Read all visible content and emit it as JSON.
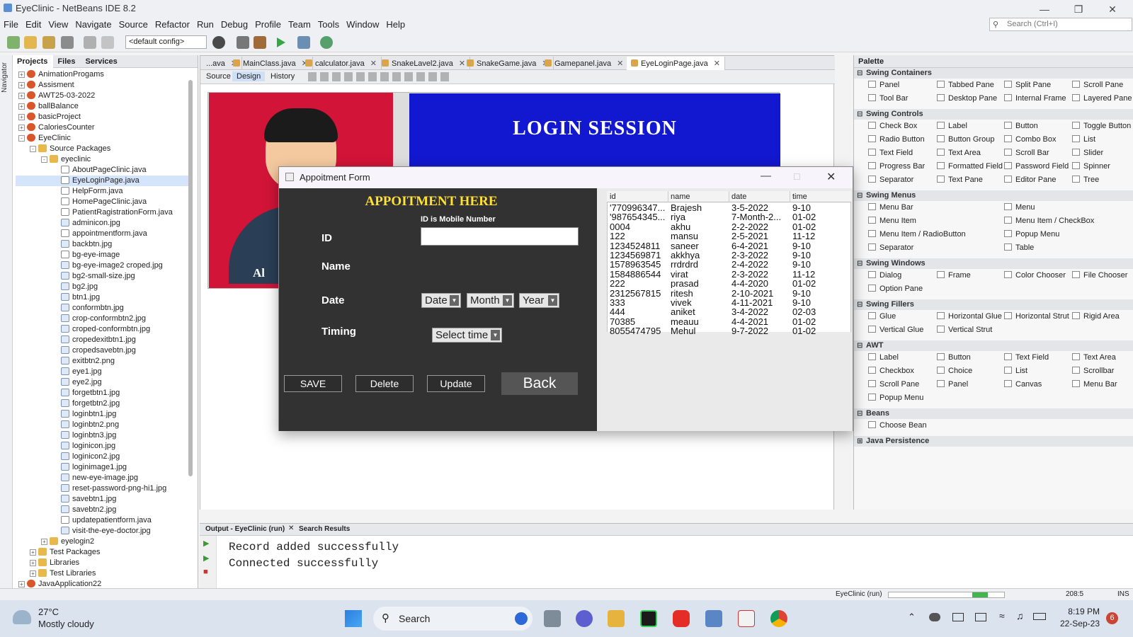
{
  "window": {
    "title": "EyeClinic - NetBeans IDE 8.2"
  },
  "menubar": [
    "File",
    "Edit",
    "View",
    "Navigate",
    "Source",
    "Refactor",
    "Run",
    "Debug",
    "Profile",
    "Team",
    "Tools",
    "Window",
    "Help"
  ],
  "toolbar": {
    "config": "<default config>",
    "search_placeholder": "Search (Ctrl+I)"
  },
  "left_panel": {
    "tabs": [
      "Projects",
      "Files",
      "Services"
    ],
    "side_label": "Navigator",
    "tree": [
      {
        "label": "AnimationProgams",
        "depth": 0,
        "type": "cup",
        "exp": "+"
      },
      {
        "label": "Assisment",
        "depth": 0,
        "type": "cup",
        "exp": "+"
      },
      {
        "label": "AWT25-03-2022",
        "depth": 0,
        "type": "cup",
        "exp": "+"
      },
      {
        "label": "ballBalance",
        "depth": 0,
        "type": "cup",
        "exp": "+"
      },
      {
        "label": "basicProject",
        "depth": 0,
        "type": "cup",
        "exp": "+"
      },
      {
        "label": "CaloriesCounter",
        "depth": 0,
        "type": "cup",
        "exp": "+"
      },
      {
        "label": "EyeClinic",
        "depth": 0,
        "type": "cup",
        "exp": "-"
      },
      {
        "label": "Source Packages",
        "depth": 1,
        "type": "pkg",
        "exp": "-"
      },
      {
        "label": "eyeclinic",
        "depth": 2,
        "type": "pkg",
        "exp": "-"
      },
      {
        "label": "AboutPageClinic.java",
        "depth": 3,
        "type": "file"
      },
      {
        "label": "EyeLoginPage.java",
        "depth": 3,
        "type": "file",
        "selected": true
      },
      {
        "label": "HelpForm.java",
        "depth": 3,
        "type": "file"
      },
      {
        "label": "HomePageClinic.java",
        "depth": 3,
        "type": "file"
      },
      {
        "label": "PatientRagistrationForm.java",
        "depth": 3,
        "type": "file"
      },
      {
        "label": "adminicon.jpg",
        "depth": 3,
        "type": "img"
      },
      {
        "label": "appointmentform.java",
        "depth": 3,
        "type": "file"
      },
      {
        "label": "backbtn.jpg",
        "depth": 3,
        "type": "img"
      },
      {
        "label": "bg-eye-image",
        "depth": 3,
        "type": "file"
      },
      {
        "label": "bg-eye-image2 croped.jpg",
        "depth": 3,
        "type": "img"
      },
      {
        "label": "bg2-small-size.jpg",
        "depth": 3,
        "type": "img"
      },
      {
        "label": "bg2.jpg",
        "depth": 3,
        "type": "img"
      },
      {
        "label": "btn1.jpg",
        "depth": 3,
        "type": "img"
      },
      {
        "label": "conformbtn.jpg",
        "depth": 3,
        "type": "img"
      },
      {
        "label": "crop-conformbtn2.jpg",
        "depth": 3,
        "type": "img"
      },
      {
        "label": "croped-conformbtn.jpg",
        "depth": 3,
        "type": "img"
      },
      {
        "label": "cropedexitbtn1.jpg",
        "depth": 3,
        "type": "img"
      },
      {
        "label": "cropedsavebtn.jpg",
        "depth": 3,
        "type": "img"
      },
      {
        "label": "exitbtn2.png",
        "depth": 3,
        "type": "img"
      },
      {
        "label": "eye1.jpg",
        "depth": 3,
        "type": "img"
      },
      {
        "label": "eye2.jpg",
        "depth": 3,
        "type": "img"
      },
      {
        "label": "forgetbtn1.jpg",
        "depth": 3,
        "type": "img"
      },
      {
        "label": "forgetbtn2.jpg",
        "depth": 3,
        "type": "img"
      },
      {
        "label": "loginbtn1.jpg",
        "depth": 3,
        "type": "img"
      },
      {
        "label": "loginbtn2.png",
        "depth": 3,
        "type": "img"
      },
      {
        "label": "loginbtn3.jpg",
        "depth": 3,
        "type": "img"
      },
      {
        "label": "loginicon.jpg",
        "depth": 3,
        "type": "img"
      },
      {
        "label": "loginicon2.jpg",
        "depth": 3,
        "type": "img"
      },
      {
        "label": "loginimage1.jpg",
        "depth": 3,
        "type": "img"
      },
      {
        "label": "new-eye-image.jpg",
        "depth": 3,
        "type": "img"
      },
      {
        "label": "reset-password-png-hi1.jpg",
        "depth": 3,
        "type": "img"
      },
      {
        "label": "savebtn1.jpg",
        "depth": 3,
        "type": "img"
      },
      {
        "label": "savebtn2.jpg",
        "depth": 3,
        "type": "img"
      },
      {
        "label": "updatepatientform.java",
        "depth": 3,
        "type": "file"
      },
      {
        "label": "visit-the-eye-doctor.jpg",
        "depth": 3,
        "type": "img"
      },
      {
        "label": "eyelogin2",
        "depth": 2,
        "type": "pkg",
        "exp": "+"
      },
      {
        "label": "Test Packages",
        "depth": 1,
        "type": "pkg",
        "exp": "+"
      },
      {
        "label": "Libraries",
        "depth": 1,
        "type": "pkg",
        "exp": "+"
      },
      {
        "label": "Test Libraries",
        "depth": 1,
        "type": "pkg",
        "exp": "+"
      },
      {
        "label": "JavaApplication22",
        "depth": 0,
        "type": "cup",
        "exp": "+"
      }
    ]
  },
  "editor": {
    "tabs": [
      "...ava",
      "MainClass.java",
      "calculator.java",
      "SnakeLavel2.java",
      "SnakeGame.java",
      "Gamepanel.java",
      "EyeLoginPage.java"
    ],
    "active_tab": "EyeLoginPage.java",
    "views": [
      "Source",
      "Design",
      "History"
    ],
    "login_title": "LOGIN SESSION",
    "login_partial": "Al"
  },
  "dialog": {
    "title": "Appoitment Form",
    "heading": "APPOITMENT HERE",
    "id_hint": "ID is Mobile Number",
    "labels": {
      "id": "ID",
      "name": "Name",
      "date": "Date",
      "timing": "Timing"
    },
    "combos": {
      "date": "Date",
      "month": "Month",
      "year": "Year",
      "time": "Select time"
    },
    "buttons": {
      "save": "SAVE",
      "delete": "Delete",
      "update": "Update",
      "back": "Back"
    },
    "table": {
      "columns": [
        "id",
        "name",
        "date",
        "time"
      ],
      "rows": [
        [
          "'770996347...",
          "Brajesh",
          "3-5-2022",
          "9-10"
        ],
        [
          "'987654345...",
          "riya",
          "7-Month-2...",
          "01-02"
        ],
        [
          "0004",
          "akhu",
          "2-2-2022",
          "01-02"
        ],
        [
          "122",
          "mansu",
          "2-5-2021",
          "11-12"
        ],
        [
          "1234524811",
          "saneer",
          "6-4-2021",
          "9-10"
        ],
        [
          "1234569871",
          "akkhya",
          "2-3-2022",
          "9-10"
        ],
        [
          "1578963545",
          "rrdrdrd",
          "2-4-2022",
          "9-10"
        ],
        [
          "1584886544",
          "virat",
          "2-3-2022",
          "11-12"
        ],
        [
          "222",
          "prasad",
          "4-4-2020",
          "01-02"
        ],
        [
          "2312567815",
          "ritesh",
          "2-10-2021",
          "9-10"
        ],
        [
          "333",
          "vivek",
          "4-11-2021",
          "9-10"
        ],
        [
          "444",
          "aniket",
          "3-4-2022",
          "02-03"
        ],
        [
          "70385",
          "meauu",
          "4-4-2021",
          "01-02"
        ],
        [
          "8055474795",
          "Mehul",
          "9-7-2022",
          "01-02"
        ]
      ]
    }
  },
  "palette": {
    "title": "Palette",
    "sections": [
      {
        "name": "Swing Containers",
        "items": [
          "Panel",
          "Tabbed Pane",
          "Split Pane",
          "Scroll Pane",
          "Tool Bar",
          "Desktop Pane",
          "Internal Frame",
          "Layered Pane"
        ]
      },
      {
        "name": "Swing Controls",
        "items": [
          "Check Box",
          "Label",
          "Button",
          "Toggle Button",
          "Radio Button",
          "Button Group",
          "Combo Box",
          "List",
          "Text Field",
          "Text Area",
          "Scroll Bar",
          "Slider",
          "Progress Bar",
          "Formatted Field",
          "Password Field",
          "Spinner",
          "Separator",
          "Text Pane",
          "Editor Pane",
          "Tree"
        ]
      },
      {
        "name": "Swing Menus",
        "items": [
          "Menu Bar",
          "",
          "Menu",
          "",
          "Menu Item",
          "",
          "Menu Item / CheckBox",
          "",
          "Menu Item / RadioButton",
          "",
          "Popup Menu",
          "",
          "Separator",
          "",
          "Table",
          ""
        ]
      },
      {
        "name": "Swing Windows",
        "items": [
          "Dialog",
          "Frame",
          "Color Chooser",
          "File Chooser",
          "Option Pane",
          "",
          "",
          ""
        ]
      },
      {
        "name": "Swing Fillers",
        "items": [
          "Glue",
          "Horizontal Glue",
          "Horizontal Strut",
          "Rigid Area",
          "Vertical Glue",
          "Vertical Strut",
          "",
          ""
        ]
      },
      {
        "name": "AWT",
        "items": [
          "Label",
          "Button",
          "Text Field",
          "Text Area",
          "Checkbox",
          "Choice",
          "List",
          "Scrollbar",
          "Scroll Pane",
          "Panel",
          "Canvas",
          "Menu Bar",
          "Popup Menu",
          "",
          "",
          ""
        ]
      },
      {
        "name": "Beans",
        "items": [
          "Choose Bean",
          "",
          "",
          ""
        ]
      },
      {
        "name": "Java Persistence",
        "items": []
      }
    ]
  },
  "output": {
    "tabs": [
      "Output - EyeClinic (run)",
      "Search Results"
    ],
    "lines": [
      "Record added successfully",
      "Connected successfully"
    ]
  },
  "statusbar": {
    "run": "EyeClinic (run)",
    "position": "208:5",
    "mode": "INS"
  },
  "taskbar": {
    "temp": "27°C",
    "weather": "Mostly cloudy",
    "search": "Search",
    "time": "8:19 PM",
    "date": "22-Sep-23",
    "badge": "6"
  }
}
